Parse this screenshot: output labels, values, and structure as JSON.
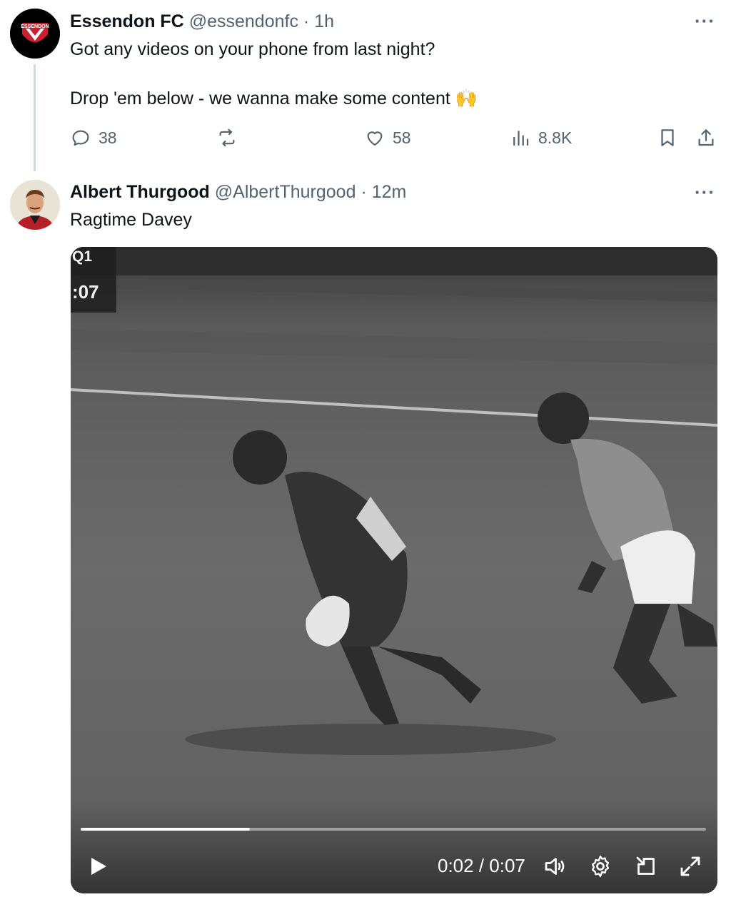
{
  "tweets": [
    {
      "author_name": "Essendon FC",
      "handle": "@essendonfc",
      "time": "1h",
      "text_line1": "Got any videos on your phone from last night?",
      "text_line2": "Drop 'em below - we wanna make some content",
      "emoji": "🙌",
      "avatar_text": "ESSENDON",
      "actions": {
        "replies": "38",
        "likes": "58",
        "views": "8.8K"
      }
    },
    {
      "author_name": "Albert Thurgood",
      "handle": "@AlbertThurgood",
      "time": "12m",
      "text": "Ragtime Davey",
      "media": {
        "overlay_quarter": "Q1",
        "overlay_clock": ":07",
        "current_time": "0:02",
        "duration": "0:07",
        "time_display": "0:02 / 0:07",
        "progress": 0.27
      }
    }
  ],
  "ui": {
    "separator": "·",
    "more_glyph": "···"
  },
  "colors": {
    "text_primary": "#0f1419",
    "text_secondary": "#536471",
    "essendon_red": "#cc2031",
    "essendon_black": "#000000"
  }
}
